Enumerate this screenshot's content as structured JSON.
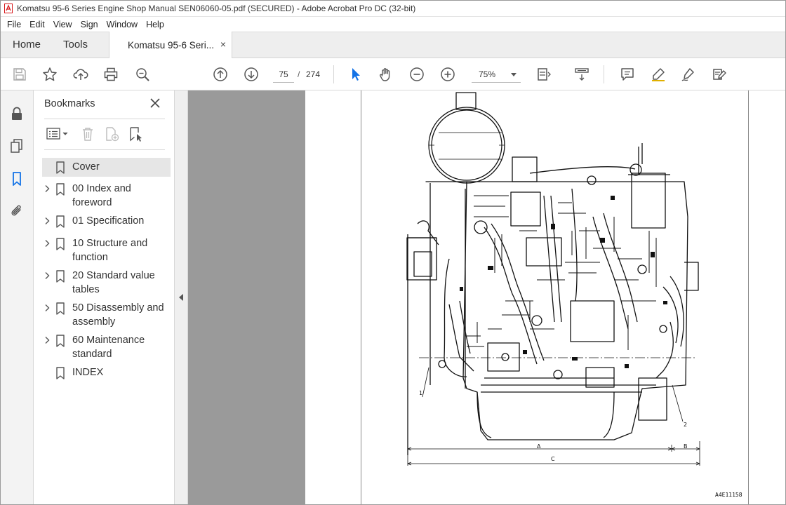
{
  "window": {
    "title": "Komatsu 95-6 Series Engine Shop Manual SEN06060-05.pdf (SECURED) - Adobe Acrobat Pro DC (32-bit)",
    "app_icon": "acrobat-pdf-icon"
  },
  "menu": [
    "File",
    "Edit",
    "View",
    "Sign",
    "Window",
    "Help"
  ],
  "tabs": {
    "home": "Home",
    "tools": "Tools",
    "document": "Komatsu 95-6 Seri...",
    "document_close": "×"
  },
  "toolbar": {
    "icons": [
      "save-icon",
      "star-icon",
      "upload-icon",
      "print-icon",
      "zoom-search-icon",
      "page-up-icon",
      "page-down-icon",
      "select-cursor-icon",
      "hand-icon",
      "zoom-out-icon",
      "zoom-in-icon",
      "fit-page-icon",
      "scroll-mode-icon",
      "comment-icon",
      "highlight-pen-icon",
      "sign-pen-icon",
      "edit-pdf-icon"
    ],
    "page_current": "75",
    "page_separator": "/",
    "page_total": "274",
    "zoom": "75%"
  },
  "left_rail": [
    "lock-icon",
    "pages-icon",
    "bookmark-icon",
    "attachment-icon"
  ],
  "bookmarks": {
    "title": "Bookmarks",
    "items": [
      {
        "label": "Cover",
        "expandable": false,
        "selected": true
      },
      {
        "label": "00 Index and foreword",
        "expandable": true
      },
      {
        "label": "01 Specification",
        "expandable": true
      },
      {
        "label": "10 Structure and function",
        "expandable": true
      },
      {
        "label": "20 Standard value tables",
        "expandable": true
      },
      {
        "label": "50 Disassembly and assembly",
        "expandable": true
      },
      {
        "label": "60 Maintenance standard",
        "expandable": true
      },
      {
        "label": "INDEX",
        "expandable": false
      }
    ]
  },
  "document_page": {
    "figure_labels": {
      "callout_1": "1",
      "callout_2": "2",
      "dimension_a": "A",
      "dimension_b": "B",
      "dimension_c": "C"
    },
    "figure_id": "A4E11158"
  },
  "colors": {
    "acrobat_red": "#d7191c",
    "active_blue": "#1473e6",
    "icon_gray": "#555555",
    "page_gray": "#9a9a9a"
  }
}
